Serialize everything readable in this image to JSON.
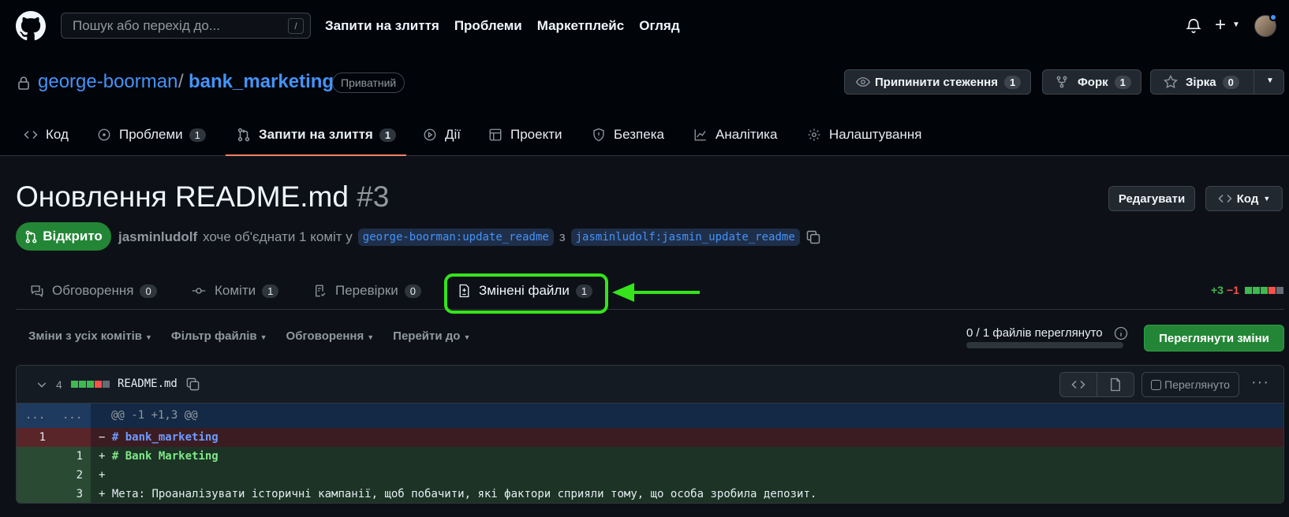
{
  "header": {
    "search_placeholder": "Пошук або перехід до...",
    "search_shortcut": "/",
    "nav": [
      "Запити на злиття",
      "Проблеми",
      "Маркетплейс",
      "Огляд"
    ]
  },
  "repo": {
    "owner": "george-boorman",
    "separator": "/",
    "name": "bank_marketing",
    "visibility": "Приватний",
    "watch_label": "Припинити стеження",
    "watch_count": "1",
    "fork_label": "Форк",
    "fork_count": "1",
    "star_label": "Зірка",
    "star_count": "0",
    "tabs": [
      {
        "label": "Код",
        "count": ""
      },
      {
        "label": "Проблеми",
        "count": "1"
      },
      {
        "label": "Запити на злиття",
        "count": "1"
      },
      {
        "label": "Дії",
        "count": ""
      },
      {
        "label": "Проекти",
        "count": ""
      },
      {
        "label": "Безпека",
        "count": ""
      },
      {
        "label": "Аналітика",
        "count": ""
      },
      {
        "label": "Налаштування",
        "count": ""
      }
    ]
  },
  "pr": {
    "title": "Оновлення README.md",
    "number": "#3",
    "edit_label": "Редагувати",
    "code_label": "Код",
    "state": "Відкрито",
    "author": "jasminludolf",
    "action_text": "хоче об'єднати 1 коміт у",
    "base_branch": "george-boorman:update_readme",
    "from_word": "з",
    "head_branch": "jasminludolf:jasmin_update_readme",
    "tabs": [
      {
        "label": "Обговорення",
        "count": "0"
      },
      {
        "label": "Коміти",
        "count": "1"
      },
      {
        "label": "Перевірки",
        "count": "0"
      },
      {
        "label": "Змінені файли",
        "count": "1"
      }
    ],
    "additions": "+3",
    "deletions": "−1"
  },
  "toolbar": {
    "filters": [
      "Зміни з усіх комітів",
      "Фільтр файлів",
      "Обговорення",
      "Перейти до"
    ],
    "viewed_count": "0 / 1 файлів переглянуто",
    "viewed_progress": 0,
    "review_label": "Переглянути зміни"
  },
  "file": {
    "change_count": "4",
    "name": "README.md",
    "viewed_label": "Переглянуто",
    "more": "···",
    "hunk_ln": "...",
    "hunk": "@@ -1 +1,3 @@",
    "lines": [
      {
        "old": "1",
        "new": "",
        "sign": "−",
        "text": "# bank_marketing"
      },
      {
        "old": "",
        "new": "1",
        "sign": "+",
        "text": "# Bank Marketing"
      },
      {
        "old": "",
        "new": "2",
        "sign": "+",
        "text": ""
      },
      {
        "old": "",
        "new": "3",
        "sign": "+",
        "text": "Мета: Проаналізувати історичні кампанії, щоб побачити, які фактори сприяли тому, що особа зробила депозит."
      }
    ]
  },
  "colors": {
    "accent_link": "#4493f8",
    "highlight_box": "#35e41b",
    "open_green": "#238636",
    "active_underline": "#f78166"
  }
}
